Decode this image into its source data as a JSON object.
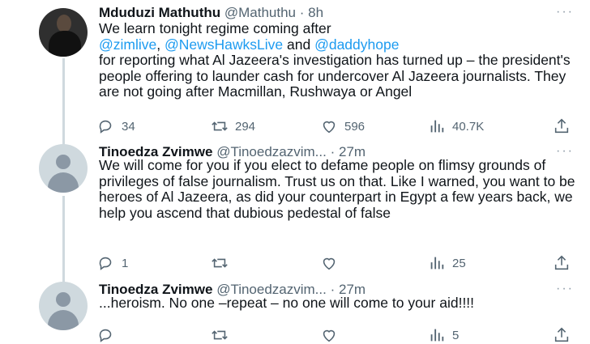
{
  "tweets": [
    {
      "name": "Mduduzi Mathuthu",
      "handle": "@Mathuthu",
      "sep": "·",
      "time": "8h",
      "text_line1": "We learn tonight regime coming after",
      "mention1": "@zimlive",
      "comma": ",",
      "mention2": "@NewsHawksLive",
      "and": " and ",
      "mention3": "@daddyhope",
      "text_rest": "for reporting what Al Jazeera's investigation has turned up – the president's people offering to launder cash for undercover Al Jazeera journalists. They are not going after Macmillan, Rushwaya or Angel",
      "replies": "34",
      "retweets": "294",
      "likes": "596",
      "views": "40.7K"
    },
    {
      "name": "Tinoedza Zvimwe",
      "handle": "@Tinoedzazvim...",
      "sep": "·",
      "time": "27m",
      "text": "We will come for you if you elect to defame people on flimsy grounds of privileges of false journalism. Trust us on that. Like I warned, you want to be heroes of Al Jazeera, as did your counterpart in Egypt a few years back, we help you ascend that dubious pedestal of false",
      "replies": "1",
      "retweets": "",
      "likes": "",
      "views": "25"
    },
    {
      "name": "Tinoedza Zvimwe",
      "handle": "@Tinoedzazvim...",
      "sep": "·",
      "time": "27m",
      "text": "...heroism. No one –repeat – no one will come to your aid!!!!",
      "replies": "",
      "retweets": "",
      "likes": "",
      "views": "5"
    }
  ],
  "icons": {
    "reply": "reply-icon",
    "retweet": "retweet-icon",
    "like": "heart-icon",
    "views": "views-icon",
    "share": "share-icon",
    "more": "more-icon"
  },
  "colors": {
    "link": "#1d9bf0",
    "secondary": "#536471",
    "text": "#0f1419"
  }
}
